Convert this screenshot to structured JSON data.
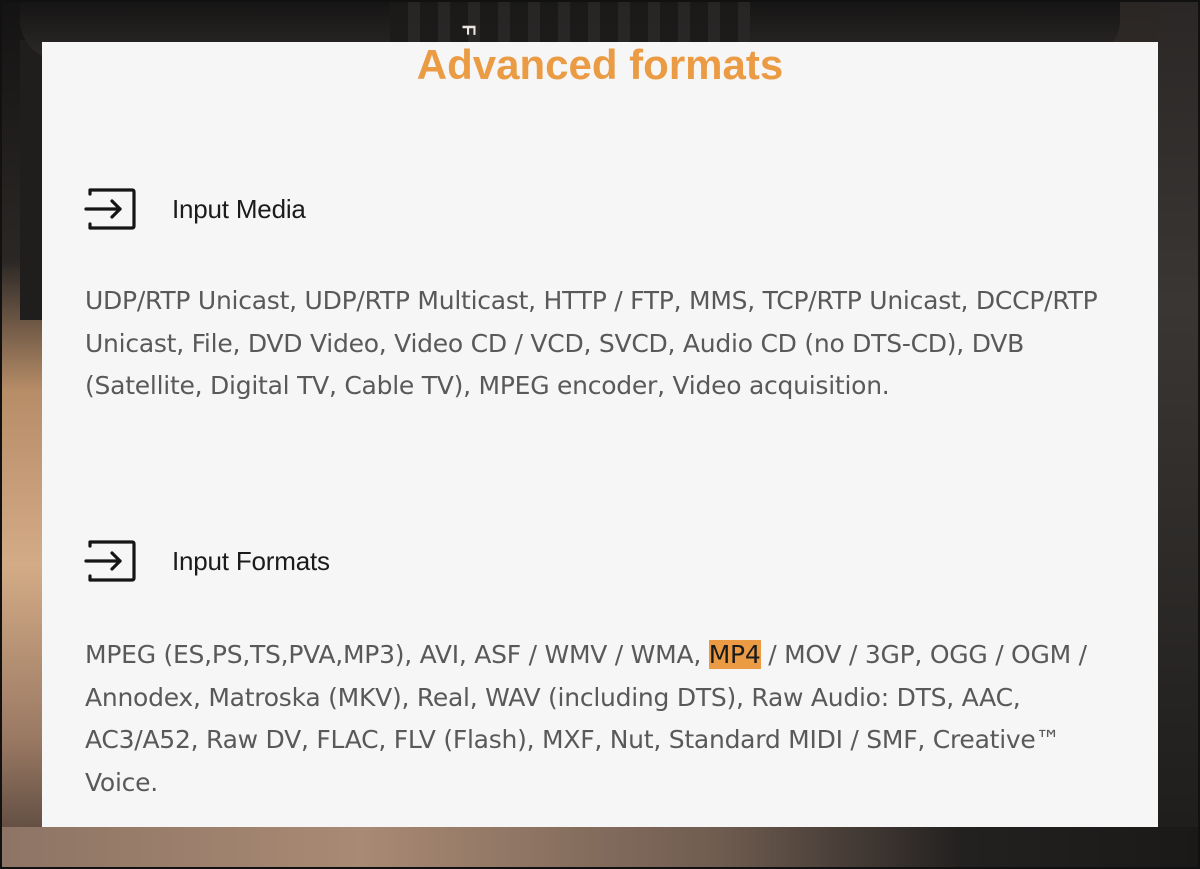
{
  "background": {
    "camera_mark": "F"
  },
  "page": {
    "title": "Advanced formats",
    "accent_color": "#ea9b44"
  },
  "sections": [
    {
      "icon": "input-arrow-icon",
      "heading": "Input Media",
      "body": "UDP/RTP Unicast, UDP/RTP Multicast, HTTP / FTP, MMS, TCP/RTP Unicast, DCCP/RTP Unicast, File, DVD Video, Video CD / VCD, SVCD, Audio CD (no DTS-CD), DVB (Satellite, Digital TV, Cable TV), MPEG encoder, Video acquisition."
    },
    {
      "icon": "input-arrow-icon",
      "heading": "Input Formats",
      "body_before": "MPEG (ES,PS,TS,PVA,MP3), AVI, ASF / WMV / WMA, ",
      "body_highlight": "MP4",
      "body_after": " / MOV / 3GP, OGG / OGM / Annodex, Matroska (MKV), Real, WAV (including DTS), Raw Audio: DTS, AAC, AC3/A52, Raw DV, FLAC, FLV (Flash), MXF, Nut, Standard MIDI / SMF, Creative™ Voice."
    }
  ]
}
